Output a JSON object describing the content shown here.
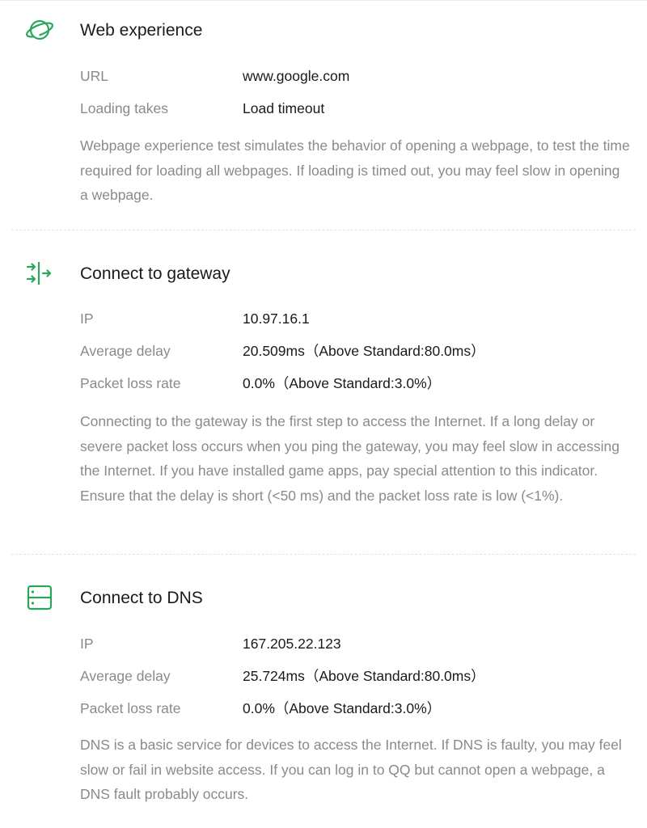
{
  "accent_color": "#2aa55a",
  "sections": [
    {
      "icon": "planet-icon",
      "title": "Web experience",
      "rows": [
        {
          "label": "URL",
          "value": "www.google.com"
        },
        {
          "label": "Loading takes",
          "value": "Load timeout"
        }
      ],
      "description": "Webpage experience test simulates the behavior of opening a webpage, to test the time required for loading all webpages. If loading is timed out, you may feel slow in opening a webpage."
    },
    {
      "icon": "gateway-connect-icon",
      "title": "Connect to gateway",
      "rows": [
        {
          "label": "IP",
          "value": "10.97.16.1"
        },
        {
          "label": "Average delay",
          "value": "20.509ms（Above Standard:80.0ms）"
        },
        {
          "label": "Packet loss rate",
          "value": "0.0%（Above Standard:3.0%）"
        }
      ],
      "description": "Connecting to the gateway is the first step to access the Internet. If a long delay or severe packet loss occurs when you ping the gateway, you may feel slow in accessing the Internet. If you have installed game apps, pay special attention to this indicator. Ensure that the delay is short (<50 ms) and the packet loss rate is low (<1%)."
    },
    {
      "icon": "dns-server-icon",
      "title": "Connect to DNS",
      "rows": [
        {
          "label": "IP",
          "value": "167.205.22.123"
        },
        {
          "label": "Average delay",
          "value": "25.724ms（Above Standard:80.0ms）"
        },
        {
          "label": "Packet loss rate",
          "value": "0.0%（Above Standard:3.0%）"
        }
      ],
      "description": "DNS is a basic service for devices to access the Internet. If DNS is faulty, you may feel slow or fail in website access. If you can log in to QQ but cannot open a webpage, a DNS fault probably occurs."
    }
  ]
}
